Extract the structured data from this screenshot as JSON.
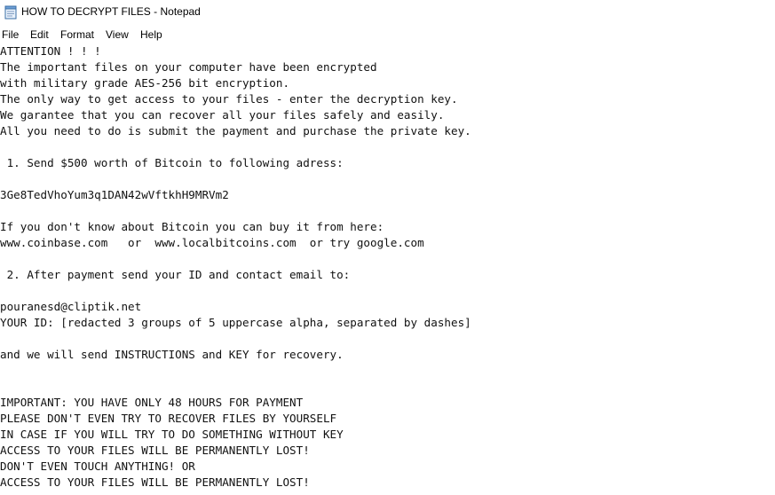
{
  "window": {
    "title": "HOW TO DECRYPT FILES - Notepad",
    "icon": "notepad-icon"
  },
  "menu": {
    "items": [
      "File",
      "Edit",
      "Format",
      "View",
      "Help"
    ]
  },
  "document": {
    "lines": [
      "ATTENTION ! ! !",
      "The important files on your computer have been encrypted",
      "with military grade AES-256 bit encryption.",
      "The only way to get access to your files - enter the decryption key.",
      "We garantee that you can recover all your files safely and easily.",
      "All you need to do is submit the payment and purchase the private key.",
      "",
      " 1. Send $500 worth of Bitcoin to following adress:",
      "",
      "3Ge8TedVhoYum3q1DAN42wVftkhH9MRVm2",
      "",
      "If you don't know about Bitcoin you can buy it from here:",
      "www.coinbase.com   or  www.localbitcoins.com  or try google.com",
      "",
      " 2. After payment send your ID and contact email to:",
      "",
      "pouranesd@cliptik.net",
      "YOUR ID: [redacted 3 groups of 5 uppercase alpha, separated by dashes]",
      "",
      "and we will send INSTRUCTIONS and KEY for recovery.",
      "",
      "",
      "IMPORTANT: YOU HAVE ONLY 48 HOURS FOR PAYMENT",
      "PLEASE DON'T EVEN TRY TO RECOVER FILES BY YOURSELF",
      "IN CASE IF YOU WILL TRY TO DO SOMETHING WITHOUT KEY",
      "ACCESS TO YOUR FILES WILL BE PERMANENTLY LOST!",
      "DON'T EVEN TOUCH ANYTHING! OR",
      "ACCESS TO YOUR FILES WILL BE PERMANENTLY LOST!"
    ]
  }
}
